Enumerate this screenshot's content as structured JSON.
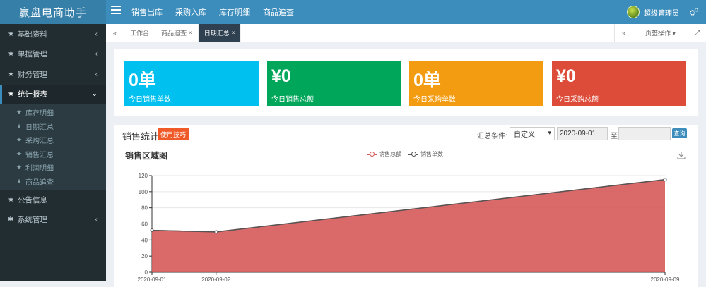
{
  "app": {
    "title": "赢盘电商助手"
  },
  "topnav": [
    "销售出库",
    "采购入库",
    "库存明细",
    "商品追查"
  ],
  "user": {
    "name": "超级管理员"
  },
  "sidebar": {
    "items": [
      {
        "label": "基础资料",
        "chev": "‹"
      },
      {
        "label": "单据管理",
        "chev": "‹"
      },
      {
        "label": "财务管理",
        "chev": "‹"
      },
      {
        "label": "统计报表",
        "chev": "⌄"
      }
    ],
    "sub_items": [
      "库存明细",
      "日期汇总",
      "采购汇总",
      "销售汇总",
      "利润明细",
      "商品追查"
    ],
    "items_after": [
      {
        "label": "公告信息"
      },
      {
        "label": "系统管理",
        "chev": "‹"
      }
    ]
  },
  "tabbar": {
    "prev": "«",
    "tabs": [
      {
        "label": "工作台"
      },
      {
        "label": "商品追查",
        "close": "×"
      },
      {
        "label": "日期汇总",
        "close": "×"
      }
    ],
    "next": "»",
    "page_ops": "页签操作 ▾",
    "fullscreen": "⤢"
  },
  "stats": [
    {
      "value": "0单",
      "label": "今日销售单数",
      "color": "#00c0ef"
    },
    {
      "value": "¥0",
      "label": "今日销售总额",
      "color": "#00a65a"
    },
    {
      "value": "0单",
      "label": "今日采购单数",
      "color": "#f39c12"
    },
    {
      "value": "¥0",
      "label": "今日采购总额",
      "color": "#dd4b39"
    }
  ],
  "sales": {
    "title": "销售统计",
    "tips_button": "使用技巧",
    "condition_label": "汇总条件:",
    "condition_value": "自定义",
    "date_from": "2020-09-01",
    "to_label": "至",
    "date_to": "",
    "query_button": "查询"
  },
  "chart_title": "销售区域图",
  "chart_data": {
    "type": "area",
    "x": [
      "2020-09-01",
      "2020-09-02",
      "2020-09-09"
    ],
    "series": [
      {
        "name": "销售总额",
        "values": [
          52,
          50,
          115
        ],
        "color": "#d65a5a"
      },
      {
        "name": "销售单数",
        "values": [
          52,
          50,
          115
        ],
        "color": "#555555"
      }
    ],
    "ylim": [
      0,
      120
    ],
    "yticks": [
      "0",
      "20",
      "40",
      "60",
      "80",
      "100",
      "120"
    ],
    "grid": true,
    "legend": "top-center"
  }
}
